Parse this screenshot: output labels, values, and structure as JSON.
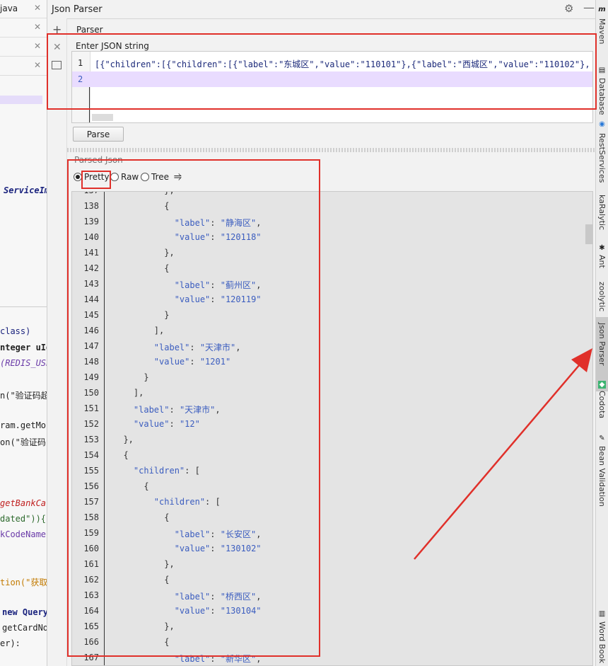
{
  "window_title": "Json Parser",
  "parser_tab": "Parser",
  "input_section_label": "Enter JSON string",
  "input_lines": [
    "[{\"children\":[{\"children\":[{\"label\":\"东城区\",\"value\":\"110101\"},{\"label\":\"西城区\",\"value\":\"110102\"},{\"",
    ""
  ],
  "input_line_numbers": [
    "1",
    "2"
  ],
  "parse_button": "Parse",
  "output_section_label": "Parsed Json",
  "view_modes": [
    "Pretty",
    "Raw",
    "Tree"
  ],
  "selected_view_mode": "Pretty",
  "left_tabs": [
    "java",
    "",
    "",
    ""
  ],
  "left_code": [
    "ServiceIm",
    "class)",
    "nteger uId",
    "(REDIS_USE",
    "n(\"验证码超",
    "ram.getMob",
    "on(\"验证码",
    "getBankCar",
    "dated\")){",
    "kCodeName\"",
    "tion(\"获取银",
    "new Query",
    "getCardNo",
    "er):"
  ],
  "right_bar": [
    "Maven",
    "Database",
    "RestServices",
    "kaRalytic",
    "Ant",
    "zoolytic",
    "Json Parser",
    "Codota",
    "Bean Validation",
    "Word Book"
  ],
  "output_lines": [
    {
      "n": "137",
      "t": "          },"
    },
    {
      "n": "138",
      "t": "          {"
    },
    {
      "n": "139",
      "t": "            \"label\": \"静海区\","
    },
    {
      "n": "140",
      "t": "            \"value\": \"120118\""
    },
    {
      "n": "141",
      "t": "          },"
    },
    {
      "n": "142",
      "t": "          {"
    },
    {
      "n": "143",
      "t": "            \"label\": \"蓟州区\","
    },
    {
      "n": "144",
      "t": "            \"value\": \"120119\""
    },
    {
      "n": "145",
      "t": "          }"
    },
    {
      "n": "146",
      "t": "        ],"
    },
    {
      "n": "147",
      "t": "        \"label\": \"天津市\","
    },
    {
      "n": "148",
      "t": "        \"value\": \"1201\""
    },
    {
      "n": "149",
      "t": "      }"
    },
    {
      "n": "150",
      "t": "    ],"
    },
    {
      "n": "151",
      "t": "    \"label\": \"天津市\","
    },
    {
      "n": "152",
      "t": "    \"value\": \"12\""
    },
    {
      "n": "153",
      "t": "  },"
    },
    {
      "n": "154",
      "t": "  {"
    },
    {
      "n": "155",
      "t": "    \"children\": ["
    },
    {
      "n": "156",
      "t": "      {"
    },
    {
      "n": "157",
      "t": "        \"children\": ["
    },
    {
      "n": "158",
      "t": "          {"
    },
    {
      "n": "159",
      "t": "            \"label\": \"长安区\","
    },
    {
      "n": "160",
      "t": "            \"value\": \"130102\""
    },
    {
      "n": "161",
      "t": "          },"
    },
    {
      "n": "162",
      "t": "          {"
    },
    {
      "n": "163",
      "t": "            \"label\": \"桥西区\","
    },
    {
      "n": "164",
      "t": "            \"value\": \"130104\""
    },
    {
      "n": "165",
      "t": "          },"
    },
    {
      "n": "166",
      "t": "          {"
    },
    {
      "n": "167",
      "t": "            \"label\": \"新华区\","
    }
  ],
  "colors": {
    "annotation_red": "#e0302a",
    "string_blue": "#3b5dbf",
    "highlight_line": "#e9dcff"
  }
}
